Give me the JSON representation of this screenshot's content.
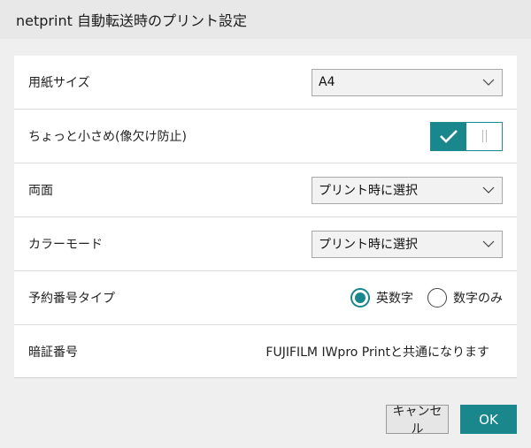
{
  "window": {
    "title": "netprint 自動転送時のプリント設定"
  },
  "settings": {
    "paper_size": {
      "label": "用紙サイズ",
      "value": "A4"
    },
    "shrink": {
      "label": "ちょっと小さめ(像欠け防止)",
      "enabled": true
    },
    "duplex": {
      "label": "両面",
      "value": "プリント時に選択"
    },
    "color_mode": {
      "label": "カラーモード",
      "value": "プリント時に選択"
    },
    "reservation_type": {
      "label": "予約番号タイプ",
      "options": [
        {
          "label": "英数字",
          "checked": true
        },
        {
          "label": "数字のみ",
          "checked": false
        }
      ]
    },
    "pin": {
      "label": "暗証番号",
      "value": "FUJIFILM IWpro Printと共通になります"
    }
  },
  "footer": {
    "cancel_label": "キャンセル",
    "ok_label": "OK"
  },
  "colors": {
    "accent": "#1a878c",
    "panel": "#ffffff",
    "background": "#efefef"
  },
  "icons": {
    "dropdown": "chevron-down-icon",
    "toggle_on": "check-icon",
    "toggle_off": "pause-bars-icon"
  }
}
